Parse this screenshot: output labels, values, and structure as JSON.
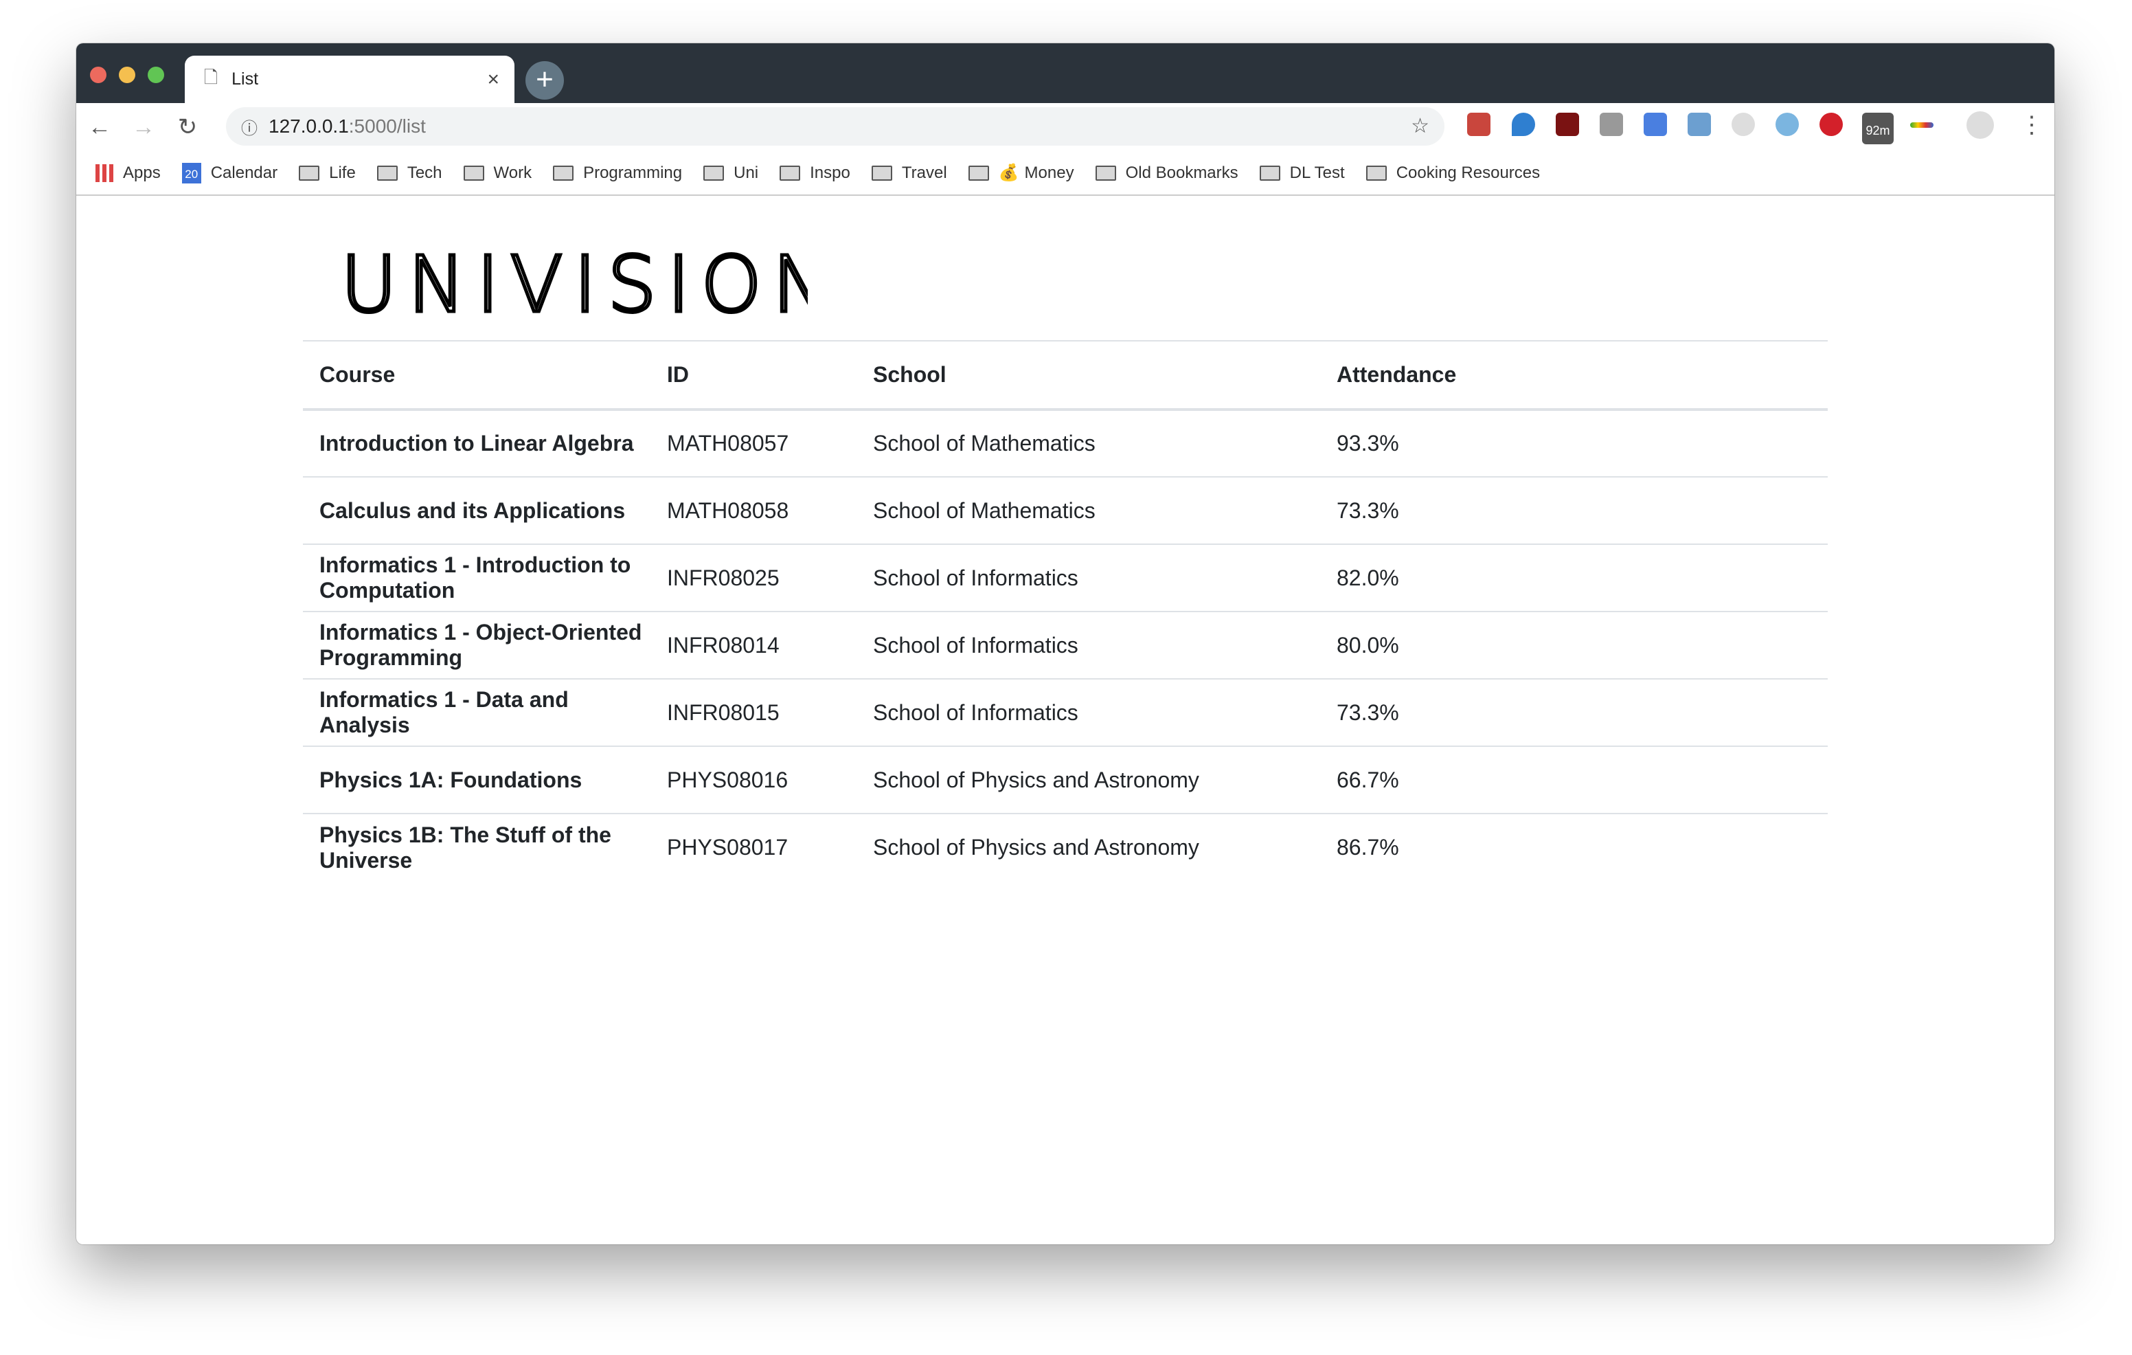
{
  "browser": {
    "tab_title": "List",
    "url_host": "127.0.0.1",
    "url_path": ":5000/list",
    "bookmarks": [
      "Apps",
      "Calendar",
      "Life",
      "Tech",
      "Work",
      "Programming",
      "Uni",
      "Inspo",
      "Travel",
      "Money",
      "Old Bookmarks",
      "DL Test",
      "Cooking Resources"
    ],
    "calendar_day": "20",
    "extension_badge": "92m"
  },
  "logo": {
    "text": "UNIVISION"
  },
  "table": {
    "headers": [
      "Course",
      "ID",
      "School",
      "Attendance"
    ],
    "rows": [
      [
        "Introduction to Linear Algebra",
        "MATH08057",
        "School of Mathematics",
        "93.3%"
      ],
      [
        "Calculus and its Applications",
        "MATH08058",
        "School of Mathematics",
        "73.3%"
      ],
      [
        "Informatics 1 - Introduction to Computation",
        "INFR08025",
        "School of Informatics",
        "82.0%"
      ],
      [
        "Informatics 1 - Object-Oriented Programming",
        "INFR08014",
        "School of Informatics",
        "80.0%"
      ],
      [
        "Informatics 1 - Data and Analysis",
        "INFR08015",
        "School of Informatics",
        "73.3%"
      ],
      [
        "Physics 1A: Foundations",
        "PHYS08016",
        "School of Physics and Astronomy",
        "66.7%"
      ],
      [
        "Physics 1B: The Stuff of the Universe",
        "PHYS08017",
        "School of Physics and Astronomy",
        "86.7%"
      ]
    ]
  },
  "colors": {
    "logo_blue": "#3b82c4",
    "logo_dark_blue": "#1d3d6b",
    "chrome_dark": "#2b333b"
  }
}
